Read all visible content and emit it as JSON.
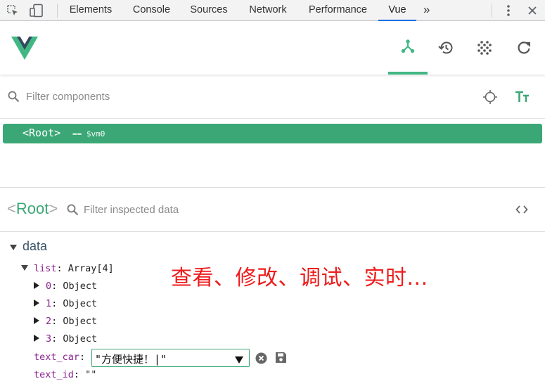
{
  "devtools": {
    "tabs": [
      {
        "label": "Elements"
      },
      {
        "label": "Console"
      },
      {
        "label": "Sources"
      },
      {
        "label": "Network"
      },
      {
        "label": "Performance"
      },
      {
        "label": "Vue"
      }
    ],
    "active_tab": "Vue",
    "more_label": "»",
    "icons": [
      "inspect-element-icon",
      "device-toolbar-icon",
      "kebab-menu-icon",
      "close-icon"
    ],
    "accent_color": "#1a73e8"
  },
  "vue_header": {
    "nav_icons": [
      "components-tree-icon",
      "history-icon",
      "vuex-dots-icon",
      "refresh-icon"
    ],
    "active_nav": "components-tree-icon",
    "brand_color": "#41b883"
  },
  "components_filter": {
    "placeholder": "Filter components"
  },
  "tree": {
    "root_tag": "<Root>",
    "root_ref": "== $vm0",
    "selected_color": "#3ba776"
  },
  "inspector": {
    "open_bracket": "<",
    "component_name": "Root",
    "close_bracket": ">",
    "filter_placeholder": "Filter inspected data"
  },
  "data": {
    "section_title": "data",
    "list_key": "list",
    "list_value": "Array[4]",
    "list_items": [
      {
        "key": "0",
        "value": "Object"
      },
      {
        "key": "1",
        "value": "Object"
      },
      {
        "key": "2",
        "value": "Object"
      },
      {
        "key": "3",
        "value": "Object"
      }
    ],
    "text_car_key": "text_car",
    "text_car_edit_value": "\"方便快捷！|\"",
    "text_id_key": "text_id",
    "text_id_value": "\"\""
  },
  "annotation": {
    "text": "查看、修改、调试、实时...",
    "color": "#ee1c1c"
  }
}
